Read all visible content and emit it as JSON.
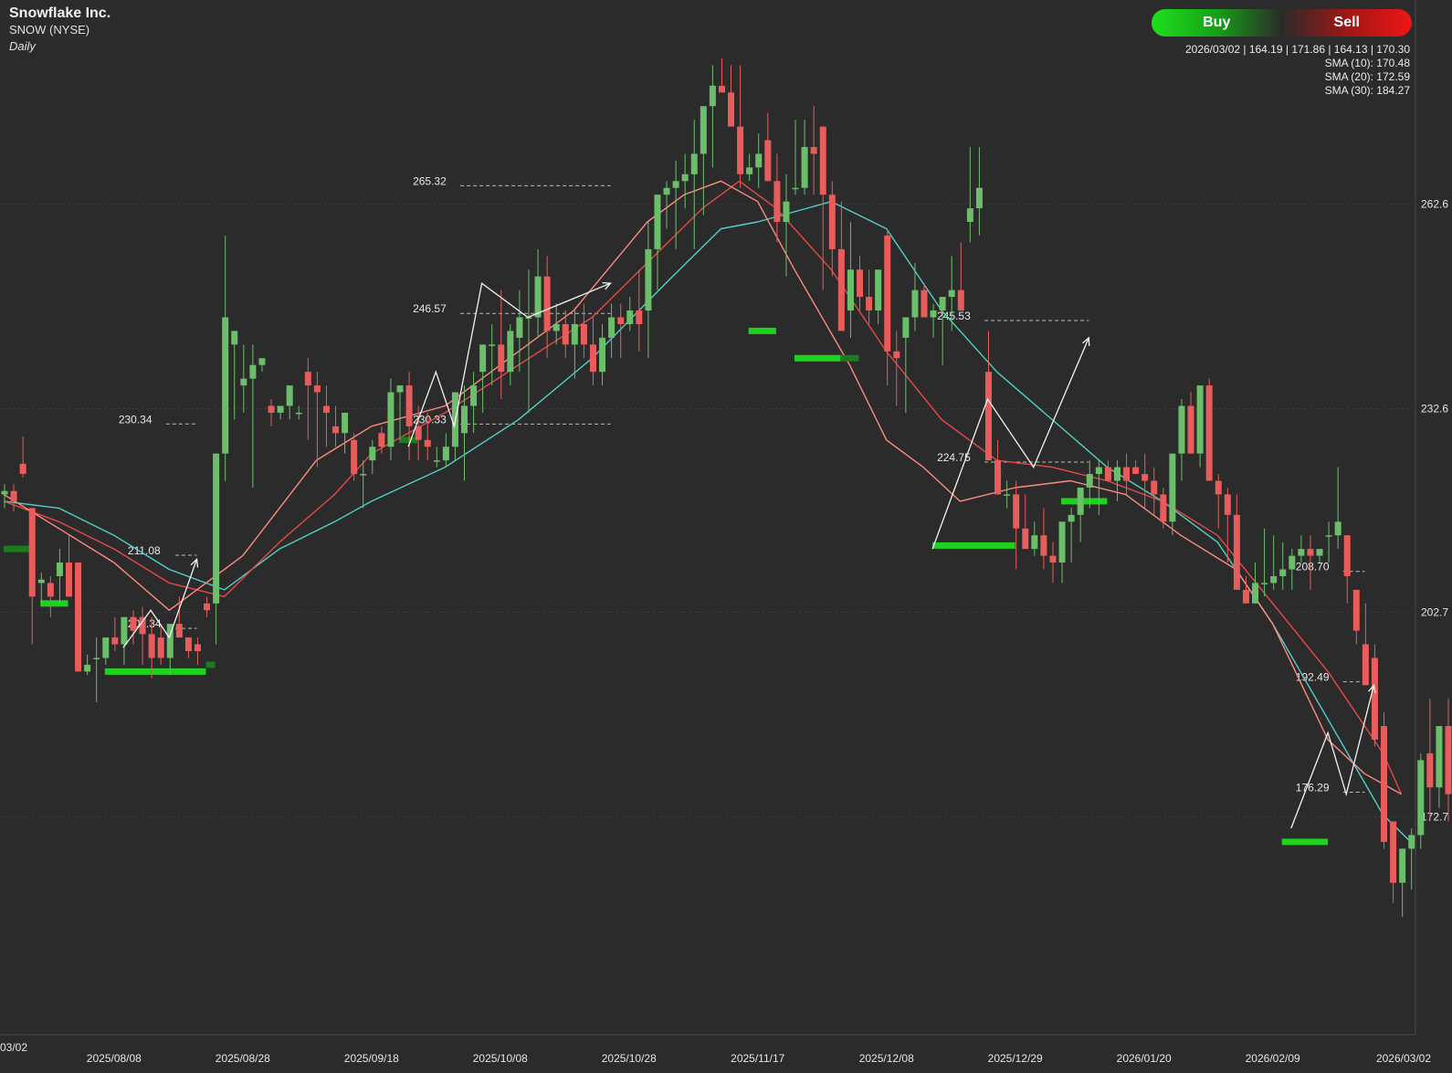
{
  "header": {
    "company": "Snowflake Inc.",
    "symbol": "SNOW (NYSE)",
    "period": "Daily"
  },
  "trade_buttons": {
    "buy": "Buy",
    "sell": "Sell"
  },
  "ohlc_line": "2026/03/02 | 164.19 | 171.86 | 164.13 | 170.30",
  "sma_labels": [
    "SMA (10): 170.48",
    "SMA (20): 172.59",
    "SMA (30): 184.27"
  ],
  "colors": {
    "background": "#2b2b2b",
    "up": "#6bbf6b",
    "down": "#e85c5c",
    "sma10": "#ff8a80",
    "sma20": "#e84848",
    "sma30": "#4fd1c5",
    "support": "#1ed21e"
  },
  "chart_data": {
    "type": "candlestick",
    "ylim": [
      142,
      292
    ],
    "y_ticks": [
      172.7,
      202.7,
      232.6,
      262.6
    ],
    "x_tick_labels": [
      "03/02",
      "2025/08/08",
      "2025/08/28",
      "2025/09/18",
      "2025/10/08",
      "2025/10/28",
      "2025/11/17",
      "2025/12/08",
      "2025/12/29",
      "2026/01/20",
      "2026/02/09",
      "2026/03/02"
    ],
    "x_tick_index": [
      0,
      12,
      26,
      40,
      54,
      68,
      82,
      96,
      110,
      124,
      138,
      152
    ],
    "candles": [
      [
        220,
        221.5,
        218,
        220.5
      ],
      [
        220.5,
        221.5,
        217.5,
        219
      ],
      [
        224.5,
        228.5,
        222.5,
        223
      ],
      [
        218,
        218,
        198,
        205
      ],
      [
        207,
        208.5,
        204,
        207.5
      ],
      [
        207,
        208,
        202,
        205
      ],
      [
        208,
        212,
        204,
        210
      ],
      [
        210,
        214,
        205,
        205
      ],
      [
        210,
        210,
        194,
        194
      ],
      [
        194,
        196.5,
        193.5,
        195
      ],
      [
        196,
        199,
        189.5,
        196
      ],
      [
        196,
        198,
        195,
        199
      ],
      [
        199,
        202,
        197,
        198
      ],
      [
        198,
        202,
        195,
        202
      ],
      [
        202,
        203,
        198,
        200
      ],
      [
        202,
        203.5,
        195,
        199.5
      ],
      [
        199.5,
        202,
        193,
        196
      ],
      [
        199,
        201,
        195,
        196
      ],
      [
        196,
        201,
        193.5,
        201
      ],
      [
        201,
        205,
        199,
        199
      ],
      [
        199,
        199,
        196,
        197
      ],
      [
        198,
        199,
        195,
        197
      ],
      [
        204,
        205,
        202,
        203
      ],
      [
        204,
        226,
        198,
        226
      ],
      [
        226,
        258,
        222,
        246
      ],
      [
        242,
        244,
        231,
        244
      ],
      [
        236,
        242,
        232,
        237
      ],
      [
        237,
        242,
        221,
        239
      ],
      [
        239,
        240,
        238,
        240
      ],
      [
        233,
        234,
        230,
        232
      ],
      [
        232,
        233,
        231,
        233
      ],
      [
        233,
        236,
        231,
        236
      ],
      [
        232,
        233,
        231,
        232
      ],
      [
        238,
        240,
        228,
        236
      ],
      [
        236,
        238,
        224,
        235
      ],
      [
        233,
        236,
        227,
        232
      ],
      [
        230,
        233,
        227,
        229
      ],
      [
        229,
        231,
        226,
        232
      ],
      [
        228,
        229,
        222,
        223
      ],
      [
        223,
        225,
        218,
        223
      ],
      [
        225,
        228,
        223,
        227
      ],
      [
        229,
        230,
        226,
        227
      ],
      [
        227,
        237,
        225,
        235
      ],
      [
        235,
        236,
        228,
        236
      ],
      [
        236,
        238,
        225,
        230
      ],
      [
        230,
        233,
        225,
        228
      ],
      [
        228,
        232,
        225,
        227
      ],
      [
        225,
        227,
        224,
        225
      ],
      [
        225,
        229,
        224,
        227
      ],
      [
        227,
        234,
        225,
        235
      ],
      [
        229,
        236,
        222,
        233
      ],
      [
        233,
        238,
        229,
        236
      ],
      [
        238,
        242,
        232,
        242
      ],
      [
        242,
        245,
        236,
        242
      ],
      [
        242,
        250,
        234,
        238
      ],
      [
        238,
        245,
        236,
        244
      ],
      [
        243,
        250,
        238,
        246
      ],
      [
        246,
        253,
        232,
        246
      ],
      [
        246,
        256,
        243,
        252
      ],
      [
        252,
        255,
        240,
        244
      ],
      [
        244,
        248,
        242,
        245
      ],
      [
        245,
        247,
        240,
        242
      ],
      [
        242,
        247,
        237,
        245
      ],
      [
        245,
        248,
        240,
        242
      ],
      [
        242,
        246,
        236,
        238
      ],
      [
        238,
        245,
        236,
        243
      ],
      [
        243,
        248,
        240,
        246
      ],
      [
        246,
        248,
        240,
        245
      ],
      [
        245,
        249,
        244,
        247
      ],
      [
        247,
        253,
        241,
        245
      ],
      [
        247,
        260,
        240,
        256
      ],
      [
        256,
        262,
        250,
        264
      ],
      [
        264,
        266,
        259,
        265
      ],
      [
        265,
        269,
        256,
        266
      ],
      [
        266,
        270,
        262,
        267
      ],
      [
        267,
        275,
        256,
        270
      ],
      [
        270,
        277,
        261,
        277
      ],
      [
        277,
        283,
        268,
        280
      ],
      [
        280,
        284,
        280,
        279
      ],
      [
        279,
        283,
        274,
        274
      ],
      [
        274,
        283,
        265,
        267
      ],
      [
        267,
        270,
        266,
        268
      ],
      [
        268,
        273,
        265,
        270
      ],
      [
        272,
        276,
        266,
        266
      ],
      [
        266,
        270,
        257,
        260
      ],
      [
        260,
        267,
        252,
        263
      ],
      [
        265,
        275,
        264,
        265
      ],
      [
        265,
        275,
        264,
        271
      ],
      [
        271,
        277,
        264,
        270
      ],
      [
        274,
        274,
        250,
        264
      ],
      [
        264,
        266,
        252,
        256
      ],
      [
        256,
        263,
        245,
        244
      ],
      [
        247,
        260,
        243,
        253
      ],
      [
        253,
        255,
        247,
        249
      ],
      [
        249,
        253,
        245,
        247
      ],
      [
        247,
        251,
        245,
        253
      ],
      [
        258,
        259,
        236,
        241
      ],
      [
        241,
        244,
        233,
        240
      ],
      [
        243,
        244,
        232,
        246
      ],
      [
        246,
        254,
        244,
        250
      ],
      [
        250,
        251,
        248,
        246
      ],
      [
        246,
        248,
        243,
        247
      ],
      [
        247,
        248,
        239,
        249
      ],
      [
        249,
        255,
        244,
        250
      ],
      [
        250,
        257,
        247,
        247
      ],
      [
        260,
        271,
        257,
        262
      ],
      [
        262,
        271,
        258,
        265
      ],
      [
        238,
        244,
        234,
        225
      ],
      [
        225,
        228,
        222,
        220
      ],
      [
        220,
        222,
        218,
        220
      ],
      [
        220,
        222,
        209,
        215
      ],
      [
        215,
        220,
        212,
        212
      ],
      [
        212,
        216,
        211,
        214
      ],
      [
        214,
        218,
        209,
        211
      ],
      [
        211,
        213,
        207,
        210
      ],
      [
        210,
        215,
        207,
        216
      ],
      [
        216,
        218,
        210,
        217
      ],
      [
        217,
        219,
        213,
        221
      ],
      [
        221,
        225,
        218,
        223
      ],
      [
        223,
        225,
        217,
        224
      ],
      [
        224,
        225,
        222,
        222
      ],
      [
        222,
        225,
        219,
        224
      ],
      [
        224,
        226,
        220,
        222
      ],
      [
        224,
        225,
        223,
        223
      ],
      [
        223,
        226,
        218,
        222
      ],
      [
        222,
        224,
        217,
        220
      ],
      [
        220,
        221,
        215,
        216
      ],
      [
        216,
        225,
        214,
        226
      ],
      [
        226,
        234,
        222,
        233
      ],
      [
        233,
        235,
        227,
        226
      ],
      [
        226,
        236,
        224,
        236
      ],
      [
        236,
        237,
        222,
        222
      ],
      [
        222,
        223,
        215,
        220
      ],
      [
        220,
        221,
        210,
        217
      ],
      [
        217,
        220,
        206,
        206
      ],
      [
        206,
        208,
        204,
        204
      ],
      [
        204,
        210,
        205,
        207
      ],
      [
        207,
        215,
        205,
        207
      ],
      [
        207,
        214,
        206,
        208
      ],
      [
        208,
        213,
        206,
        209
      ],
      [
        209,
        212,
        206,
        211
      ],
      [
        211,
        214,
        210,
        212
      ],
      [
        212,
        214,
        206,
        211
      ],
      [
        211,
        212,
        210,
        212
      ],
      [
        214,
        216,
        210,
        214
      ],
      [
        214,
        224,
        212,
        216
      ],
      [
        214,
        214,
        204,
        208
      ],
      [
        206,
        206,
        198,
        200
      ],
      [
        198,
        204,
        194,
        192
      ],
      [
        196,
        198,
        183,
        184
      ],
      [
        186,
        188,
        168,
        169
      ],
      [
        172,
        172,
        160,
        163
      ],
      [
        163,
        165,
        158,
        168
      ],
      [
        168,
        171,
        162,
        170
      ],
      [
        170,
        182,
        168,
        181
      ],
      [
        182,
        190,
        172,
        177
      ],
      [
        177,
        185,
        174,
        186
      ],
      [
        186,
        190,
        172,
        176
      ],
      [
        176,
        180,
        168,
        181
      ],
      [
        181,
        189,
        179,
        184
      ],
      [
        184,
        186,
        170,
        175
      ],
      [
        175,
        180,
        171,
        176
      ],
      [
        176,
        182,
        168,
        179
      ],
      [
        176,
        182,
        168,
        178
      ],
      [
        176,
        176,
        162,
        164
      ],
      [
        164,
        168,
        160,
        167
      ],
      [
        167,
        169,
        160,
        175
      ],
      [
        175,
        178,
        165,
        178
      ],
      [
        178,
        184,
        168,
        172
      ],
      [
        172,
        178,
        168,
        172
      ],
      [
        164,
        172,
        164,
        170
      ]
    ],
    "sma_10": [
      [
        0,
        220
      ],
      [
        6,
        215
      ],
      [
        12,
        210
      ],
      [
        18,
        203
      ],
      [
        26,
        211
      ],
      [
        34,
        225
      ],
      [
        40,
        230
      ],
      [
        48,
        233
      ],
      [
        56,
        241
      ],
      [
        62,
        247
      ],
      [
        70,
        260
      ],
      [
        74,
        264
      ],
      [
        78,
        266
      ],
      [
        82,
        263
      ],
      [
        86,
        253
      ],
      [
        92,
        239
      ],
      [
        96,
        228
      ],
      [
        100,
        224
      ],
      [
        104,
        219
      ],
      [
        110,
        221
      ],
      [
        116,
        222
      ],
      [
        122,
        220
      ],
      [
        128,
        214
      ],
      [
        134,
        209
      ],
      [
        138,
        201
      ],
      [
        144,
        184
      ],
      [
        148,
        179
      ],
      [
        152,
        176
      ]
    ],
    "sma_20": [
      [
        0,
        219
      ],
      [
        6,
        216
      ],
      [
        12,
        212
      ],
      [
        18,
        207
      ],
      [
        24,
        205
      ],
      [
        30,
        213
      ],
      [
        36,
        220
      ],
      [
        40,
        226
      ],
      [
        48,
        232
      ],
      [
        56,
        239
      ],
      [
        64,
        246
      ],
      [
        70,
        254
      ],
      [
        76,
        262
      ],
      [
        80,
        266
      ],
      [
        84,
        262
      ],
      [
        90,
        253
      ],
      [
        96,
        241
      ],
      [
        102,
        231
      ],
      [
        108,
        225
      ],
      [
        114,
        224
      ],
      [
        120,
        222
      ],
      [
        126,
        219
      ],
      [
        132,
        214
      ],
      [
        138,
        204
      ],
      [
        144,
        194
      ],
      [
        150,
        182
      ],
      [
        152,
        176
      ]
    ],
    "sma_30": [
      [
        0,
        219
      ],
      [
        6,
        218
      ],
      [
        12,
        214
      ],
      [
        18,
        209
      ],
      [
        24,
        206
      ],
      [
        30,
        212
      ],
      [
        36,
        216
      ],
      [
        40,
        219
      ],
      [
        48,
        224
      ],
      [
        56,
        231
      ],
      [
        64,
        240
      ],
      [
        72,
        251
      ],
      [
        78,
        259
      ],
      [
        82,
        260
      ],
      [
        90,
        263
      ],
      [
        96,
        259
      ],
      [
        102,
        247
      ],
      [
        108,
        238
      ],
      [
        114,
        231
      ],
      [
        120,
        224
      ],
      [
        126,
        219
      ],
      [
        132,
        213
      ],
      [
        138,
        201
      ],
      [
        144,
        187
      ],
      [
        150,
        173
      ],
      [
        153,
        169
      ]
    ],
    "levels": [
      {
        "label": "230.34",
        "value": 230.34,
        "from": 12,
        "to": 21,
        "label_left": true
      },
      {
        "label": "211.08",
        "value": 211.08,
        "from": 13,
        "to": 21
      },
      {
        "label": "200.34",
        "value": 200.34,
        "from": 13,
        "to": 21
      },
      {
        "label": "265.32",
        "value": 265.32,
        "from": 44,
        "to": 66
      },
      {
        "label": "246.57",
        "value": 246.57,
        "from": 44,
        "to": 66
      },
      {
        "label": "230.33",
        "value": 230.33,
        "from": 44,
        "to": 66
      },
      {
        "label": "245.53",
        "value": 245.53,
        "from": 101,
        "to": 118
      },
      {
        "label": "224.75",
        "value": 224.75,
        "from": 101,
        "to": 118
      },
      {
        "label": "208.70",
        "value": 208.7,
        "from": 140,
        "to": 148
      },
      {
        "label": "192.49",
        "value": 192.49,
        "from": 140,
        "to": 148
      },
      {
        "label": "176.29",
        "value": 176.29,
        "from": 140,
        "to": 148
      }
    ],
    "support_bars": [
      {
        "from": 0,
        "to": 3,
        "value": 212,
        "dim": true
      },
      {
        "from": 4,
        "to": 7,
        "value": 204
      },
      {
        "from": 11,
        "to": 22,
        "value": 194
      },
      {
        "from": 22,
        "to": 23,
        "value": 195,
        "dim": true
      },
      {
        "from": 43,
        "to": 45,
        "value": 228,
        "dim": true
      },
      {
        "from": 81,
        "to": 84,
        "value": 244
      },
      {
        "from": 86,
        "to": 91,
        "value": 240
      },
      {
        "from": 91,
        "to": 93,
        "value": 240,
        "dim": true
      },
      {
        "from": 101,
        "to": 110,
        "value": 212.5
      },
      {
        "from": 115,
        "to": 120,
        "value": 219
      },
      {
        "from": 139,
        "to": 144,
        "value": 169
      }
    ],
    "arrows": [
      [
        [
          13,
          197.5
        ],
        [
          16,
          203
        ],
        [
          18,
          199
        ],
        [
          21,
          210.5
        ]
      ],
      [
        [
          44,
          227
        ],
        [
          47,
          238
        ],
        [
          49,
          230
        ],
        [
          52,
          251
        ],
        [
          57,
          246
        ],
        [
          66,
          251
        ]
      ],
      [
        [
          101,
          212
        ],
        [
          107,
          234
        ],
        [
          112,
          224
        ],
        [
          118,
          243
        ]
      ],
      [
        [
          140,
          171
        ],
        [
          144,
          185
        ],
        [
          146,
          176
        ],
        [
          149,
          192
        ]
      ]
    ]
  }
}
